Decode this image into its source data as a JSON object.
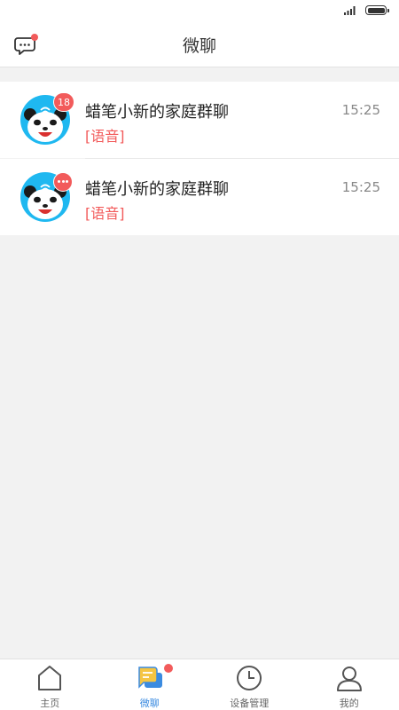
{
  "header": {
    "title": "微聊",
    "left_icon": "message-icon"
  },
  "conversations": [
    {
      "name": "蜡笔小新的家庭群聊",
      "last_message": "[语音]",
      "time": "15:25",
      "badge": "18"
    },
    {
      "name": "蜡笔小新的家庭群聊",
      "last_message": "[语音]",
      "time": "15:25",
      "badge": "more-dots"
    }
  ],
  "tabbar": {
    "tabs": [
      {
        "label": "主页",
        "icon": "home-icon"
      },
      {
        "label": "微聊",
        "icon": "chat-icon"
      },
      {
        "label": "设备管理",
        "icon": "clock-icon"
      },
      {
        "label": "我的",
        "icon": "person-icon"
      }
    ],
    "active": "微聊"
  },
  "colors": {
    "accent": "#3b8be0",
    "badge": "#f25b5b",
    "avatar_bg": "#1fb8f0"
  }
}
